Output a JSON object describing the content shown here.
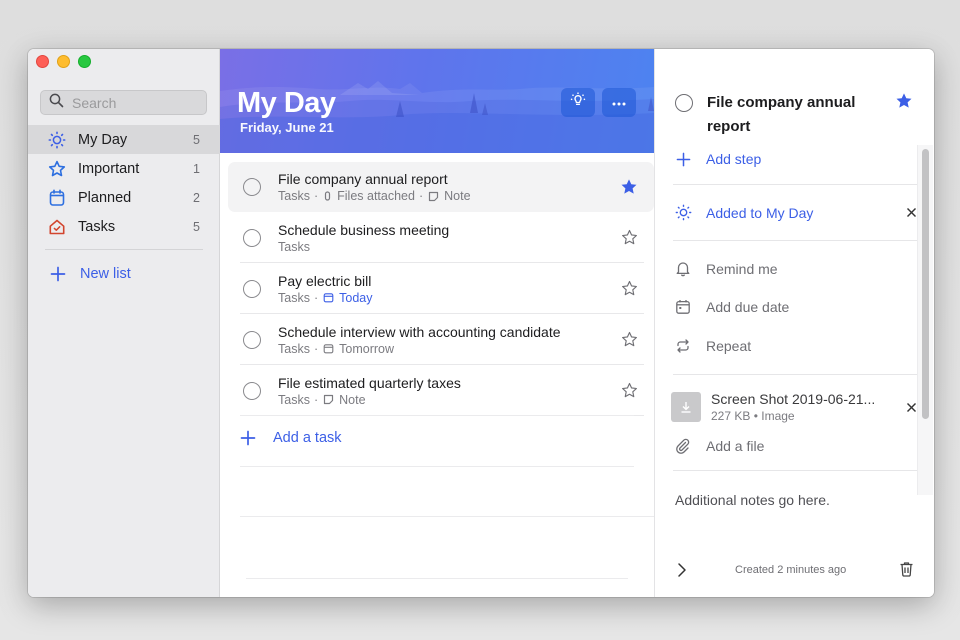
{
  "window": {
    "traffic_lights": [
      "close",
      "minimize",
      "maximize"
    ]
  },
  "sidebar": {
    "search": {
      "placeholder": "Search",
      "value": ""
    },
    "items": [
      {
        "label": "My Day",
        "count": "5",
        "icon": "sun-icon",
        "color": "#3c5fe6",
        "active": true
      },
      {
        "label": "Important",
        "count": "1",
        "icon": "star-icon",
        "color": "#2d6fe0",
        "active": false
      },
      {
        "label": "Planned",
        "count": "2",
        "icon": "calendar-icon",
        "color": "#2d6fe0",
        "active": false
      },
      {
        "label": "Tasks",
        "count": "5",
        "icon": "home-icon",
        "color": "#d2452e",
        "active": false
      }
    ],
    "new_list_label": "New list"
  },
  "header": {
    "title": "My Day",
    "date": "Friday, June 21",
    "buttons": [
      {
        "name": "suggestions",
        "icon": "lightbulb-icon"
      },
      {
        "name": "more",
        "icon": "more-icon"
      }
    ],
    "gradient": [
      "#7a6fe6",
      "#4d83f0"
    ]
  },
  "tasks": [
    {
      "title": "File company annual report",
      "list": "Tasks",
      "meta": [
        {
          "icon": "paperclip-icon",
          "text": "Files attached"
        },
        {
          "icon": "note-icon",
          "text": "Note"
        }
      ],
      "important": true,
      "selected": true
    },
    {
      "title": "Schedule business meeting",
      "list": "Tasks",
      "meta": [],
      "important": false,
      "selected": false
    },
    {
      "title": "Pay electric bill",
      "list": "Tasks",
      "meta": [
        {
          "icon": "calendar-icon",
          "text": "Today",
          "highlight": true
        }
      ],
      "important": false,
      "selected": false
    },
    {
      "title": "Schedule interview with accounting candidate",
      "list": "Tasks",
      "meta": [
        {
          "icon": "calendar-icon",
          "text": "Tomorrow"
        }
      ],
      "important": false,
      "selected": false
    },
    {
      "title": "File estimated quarterly taxes",
      "list": "Tasks",
      "meta": [
        {
          "icon": "note-icon",
          "text": "Note"
        }
      ],
      "important": false,
      "selected": false
    }
  ],
  "add_task_label": "Add a task",
  "detail": {
    "title": "File company annual report",
    "important": true,
    "add_step_label": "Add step",
    "my_day_label": "Added to My Day",
    "remind_label": "Remind me",
    "due_label": "Add due date",
    "repeat_label": "Repeat",
    "file": {
      "name": "Screen Shot 2019-06-21...",
      "size": "227 KB",
      "type": "Image",
      "meta": "227 KB • Image"
    },
    "add_file_label": "Add a file",
    "notes": "Additional notes go here.",
    "created": "Created 2 minutes ago"
  },
  "colors": {
    "accent": "#3c5fe6",
    "star_filled": "#3c5fe6",
    "tasks_icon": "#d2452e"
  }
}
